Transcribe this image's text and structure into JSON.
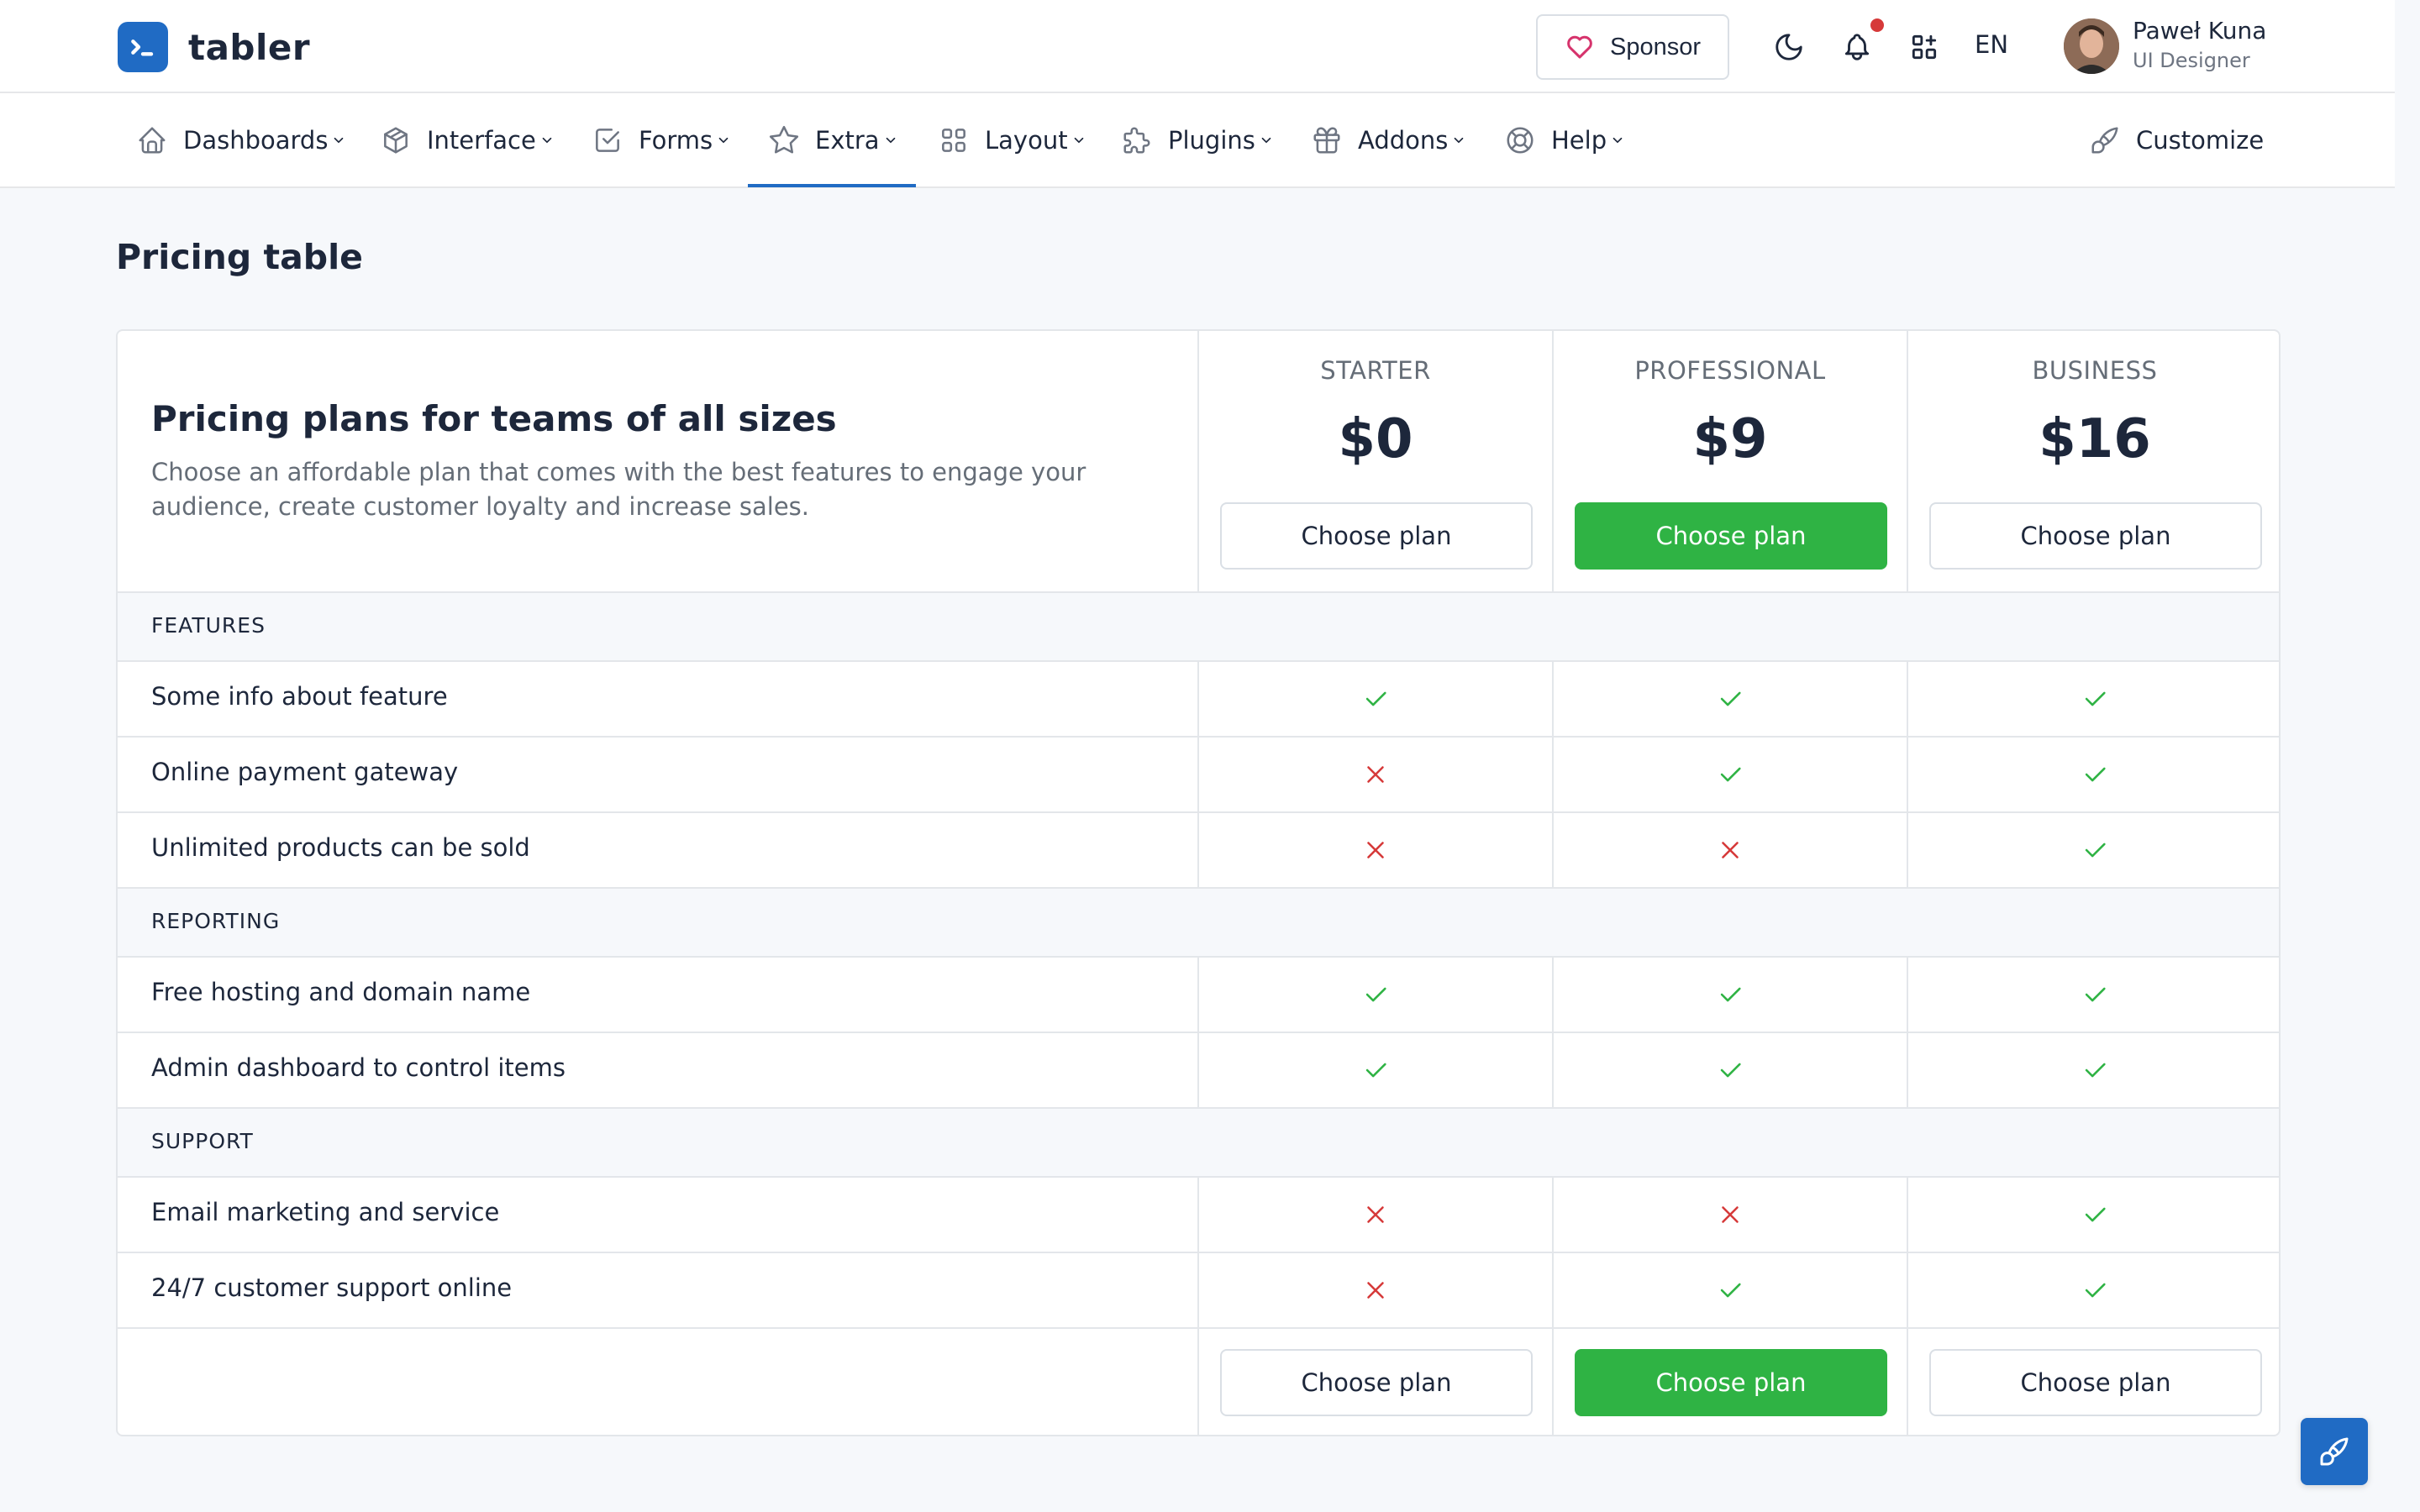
{
  "brand": {
    "name": "tabler",
    "color": "#206bc4"
  },
  "header": {
    "sponsor_label": "Sponsor",
    "language": "EN",
    "user": {
      "name": "Paweł Kuna",
      "role": "UI Designer"
    },
    "icons": [
      "heart-icon",
      "moon-icon",
      "bell-icon",
      "apps-icon"
    ]
  },
  "nav": {
    "items": [
      {
        "label": "Dashboards",
        "icon": "home-icon"
      },
      {
        "label": "Interface",
        "icon": "package-icon"
      },
      {
        "label": "Forms",
        "icon": "checkbox-icon"
      },
      {
        "label": "Extra",
        "icon": "star-icon",
        "active": true
      },
      {
        "label": "Layout",
        "icon": "layout-grid-icon"
      },
      {
        "label": "Plugins",
        "icon": "puzzle-icon"
      },
      {
        "label": "Addons",
        "icon": "gift-icon"
      },
      {
        "label": "Help",
        "icon": "lifebuoy-icon"
      }
    ],
    "customize_label": "Customize"
  },
  "page": {
    "title": "Pricing table"
  },
  "pricing": {
    "heading": "Pricing plans for teams of all sizes",
    "description": "Choose an affordable plan that comes with the best features to engage your audience, create customer loyalty and increase sales.",
    "plans": [
      {
        "name": "STARTER",
        "price": "$0",
        "button": "Choose plan",
        "primary": false
      },
      {
        "name": "PROFESSIONAL",
        "price": "$9",
        "button": "Choose plan",
        "primary": true
      },
      {
        "name": "BUSINESS",
        "price": "$16",
        "button": "Choose plan",
        "primary": false
      }
    ],
    "sections": [
      {
        "label": "FEATURES",
        "rows": [
          {
            "feature": "Some info about feature",
            "values": [
              true,
              true,
              true
            ]
          },
          {
            "feature": "Online payment gateway",
            "values": [
              false,
              true,
              true
            ]
          },
          {
            "feature": "Unlimited products can be sold",
            "values": [
              false,
              false,
              true
            ]
          }
        ]
      },
      {
        "label": "REPORTING",
        "rows": [
          {
            "feature": "Free hosting and domain name",
            "values": [
              true,
              true,
              true
            ]
          },
          {
            "feature": "Admin dashboard to control items",
            "values": [
              true,
              true,
              true
            ]
          }
        ]
      },
      {
        "label": "SUPPORT",
        "rows": [
          {
            "feature": "Email marketing and service",
            "values": [
              false,
              false,
              true
            ]
          },
          {
            "feature": "24/7 customer support online",
            "values": [
              false,
              true,
              true
            ]
          }
        ]
      }
    ],
    "colors": {
      "check": "#2fb344",
      "cross": "#d63939",
      "primary_button": "#2fb344"
    }
  }
}
